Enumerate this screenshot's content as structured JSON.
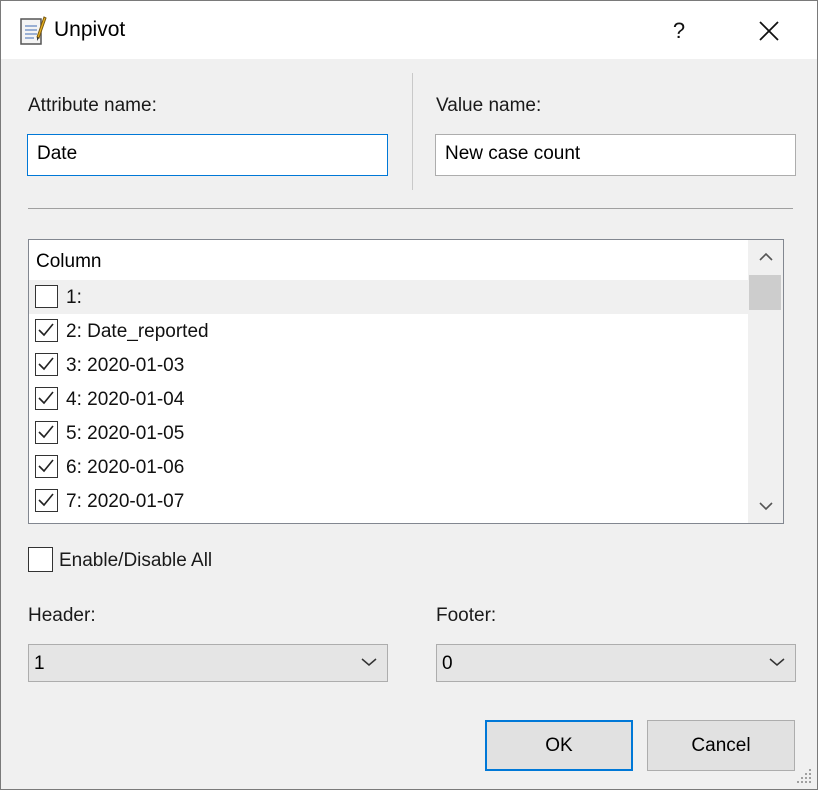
{
  "window": {
    "title": "Unpivot",
    "help_label": "?"
  },
  "fields": {
    "attribute_label": "Attribute name:",
    "attribute_value": "Date",
    "value_label": "Value name:",
    "value_value": "New case count"
  },
  "column_list": {
    "header": "Column",
    "rows": [
      {
        "label": "1:",
        "checked": false
      },
      {
        "label": "2: Date_reported",
        "checked": true
      },
      {
        "label": "3: 2020-01-03",
        "checked": true
      },
      {
        "label": "4: 2020-01-04",
        "checked": true
      },
      {
        "label": "5: 2020-01-05",
        "checked": true
      },
      {
        "label": "6: 2020-01-06",
        "checked": true
      },
      {
        "label": "7: 2020-01-07",
        "checked": true
      }
    ]
  },
  "enable_all": {
    "label": "Enable/Disable All",
    "checked": false
  },
  "header": {
    "label": "Header:",
    "value": "1"
  },
  "footer": {
    "label": "Footer:",
    "value": "0"
  },
  "buttons": {
    "ok": "OK",
    "cancel": "Cancel"
  },
  "colors": {
    "accent": "#0078d7",
    "background": "#f0f0f0"
  }
}
